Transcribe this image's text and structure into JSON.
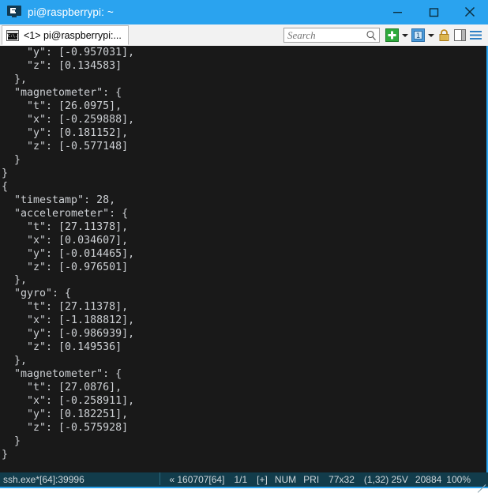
{
  "window": {
    "title": "pi@raspberrypi: ~",
    "app_icon": "terminal-monitor-icon",
    "minimize_label": "–",
    "maximize_label": "☐",
    "close_label": "✕",
    "titlebar_color": "#2aa3ef"
  },
  "toolbar": {
    "tab": {
      "icon": "console-window-icon",
      "label": "<1> pi@raspberrypi:..."
    },
    "search": {
      "placeholder": "Search",
      "value": "",
      "icon": "magnifier-icon"
    },
    "buttons": [
      {
        "name": "new-tab-button",
        "icon": "green-plus-icon",
        "color": "#2eaa3c"
      },
      {
        "name": "new-tab-dropdown",
        "icon": "chevron-down-icon"
      },
      {
        "name": "window-1-button",
        "icon": "blue-window-one-icon",
        "color": "#3b8fd4",
        "label": "1"
      },
      {
        "name": "window-dropdown",
        "icon": "chevron-down-icon"
      },
      {
        "name": "lock-button",
        "icon": "padlock-icon",
        "color": "#d9a12c"
      },
      {
        "name": "split-view-button",
        "icon": "split-pane-icon"
      },
      {
        "name": "menu-button",
        "icon": "hamburger-menu-icon",
        "color": "#2d7fc4"
      }
    ]
  },
  "terminal": {
    "background": "#191919",
    "foreground": "#cdd0d4",
    "lines": [
      "    \"y\": [-0.957031],",
      "    \"z\": [0.134583]",
      "  },",
      "  \"magnetometer\": {",
      "    \"t\": [26.0975],",
      "    \"x\": [-0.259888],",
      "    \"y\": [0.181152],",
      "    \"z\": [-0.577148]",
      "  }",
      "}",
      "{",
      "  \"timestamp\": 28,",
      "  \"accelerometer\": {",
      "    \"t\": [27.11378],",
      "    \"x\": [0.034607],",
      "    \"y\": [-0.014465],",
      "    \"z\": [-0.976501]",
      "  },",
      "  \"gyro\": {",
      "    \"t\": [27.11378],",
      "    \"x\": [-1.188812],",
      "    \"y\": [-0.986939],",
      "    \"z\": [0.149536]",
      "  },",
      "  \"magnetometer\": {",
      "    \"t\": [27.0876],",
      "    \"x\": [-0.258911],",
      "    \"y\": [0.182251],",
      "    \"z\": [-0.575928]",
      "  }",
      "}",
      ""
    ]
  },
  "statusbar": {
    "process": "ssh.exe*[64]:39996",
    "buffer_marker": "« 160707[64]",
    "pages": "1/1",
    "plus_flag": "[+]",
    "num_lock": "NUM",
    "priority": "PRI",
    "size": "77x32",
    "cursor": "(1,32) 25V",
    "lines_count": "20884",
    "zoom": "100%",
    "background": "#123c4b",
    "foreground": "#d2d8dc"
  }
}
